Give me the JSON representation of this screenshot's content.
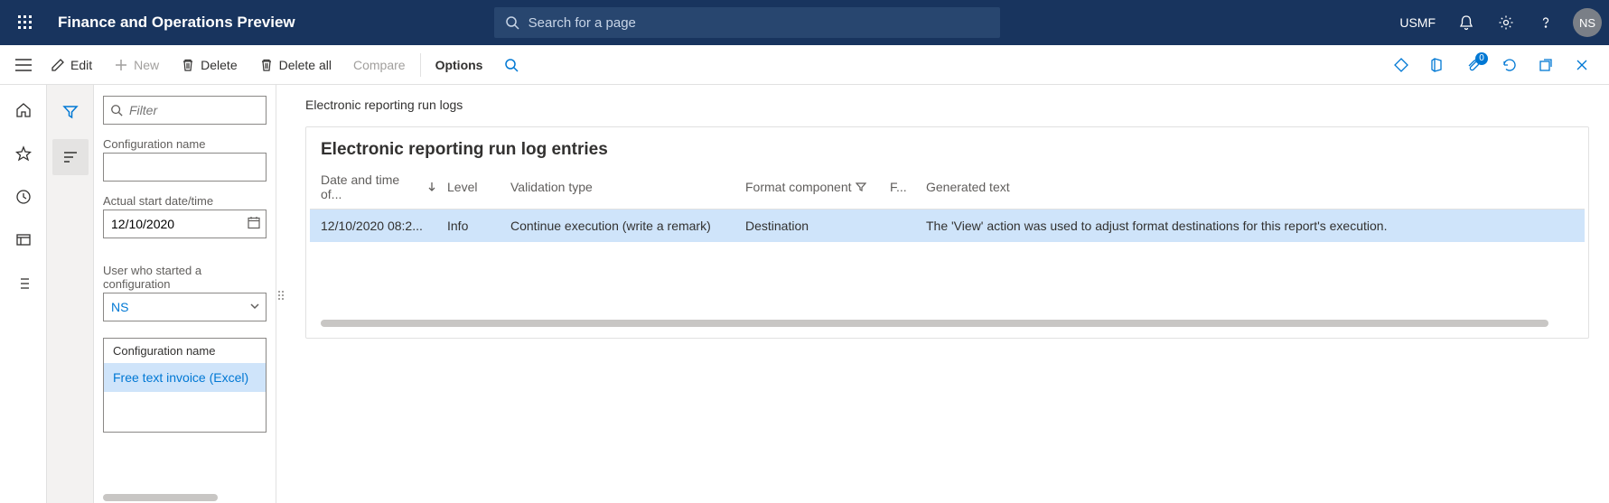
{
  "header": {
    "app_title": "Finance and Operations Preview",
    "search_placeholder": "Search for a page",
    "company": "USMF",
    "avatar_initials": "NS"
  },
  "actionbar": {
    "edit": "Edit",
    "new": "New",
    "delete": "Delete",
    "delete_all": "Delete all",
    "compare": "Compare",
    "options": "Options",
    "attachment_count": "0"
  },
  "filter": {
    "filter_placeholder": "Filter",
    "config_name_label": "Configuration name",
    "config_name_value": "",
    "actual_start_label": "Actual start date/time",
    "actual_start_value": "12/10/2020",
    "user_label": "User who started a configuration",
    "user_value": "NS",
    "config_list_header": "Configuration name",
    "config_list_item": "Free text invoice (Excel)"
  },
  "main": {
    "breadcrumb": "Electronic reporting run logs",
    "card_title": "Electronic reporting run log entries",
    "columns": {
      "c1": "Date and time of...",
      "c2": "Level",
      "c3": "Validation type",
      "c4": "Format component",
      "c5": "F...",
      "c6": "Generated text"
    },
    "row": {
      "c1": "12/10/2020 08:2...",
      "c2": "Info",
      "c3": "Continue execution (write a remark)",
      "c4": "Destination",
      "c5": "",
      "c6": "The 'View' action was used to adjust format destinations for this report's execution."
    }
  }
}
